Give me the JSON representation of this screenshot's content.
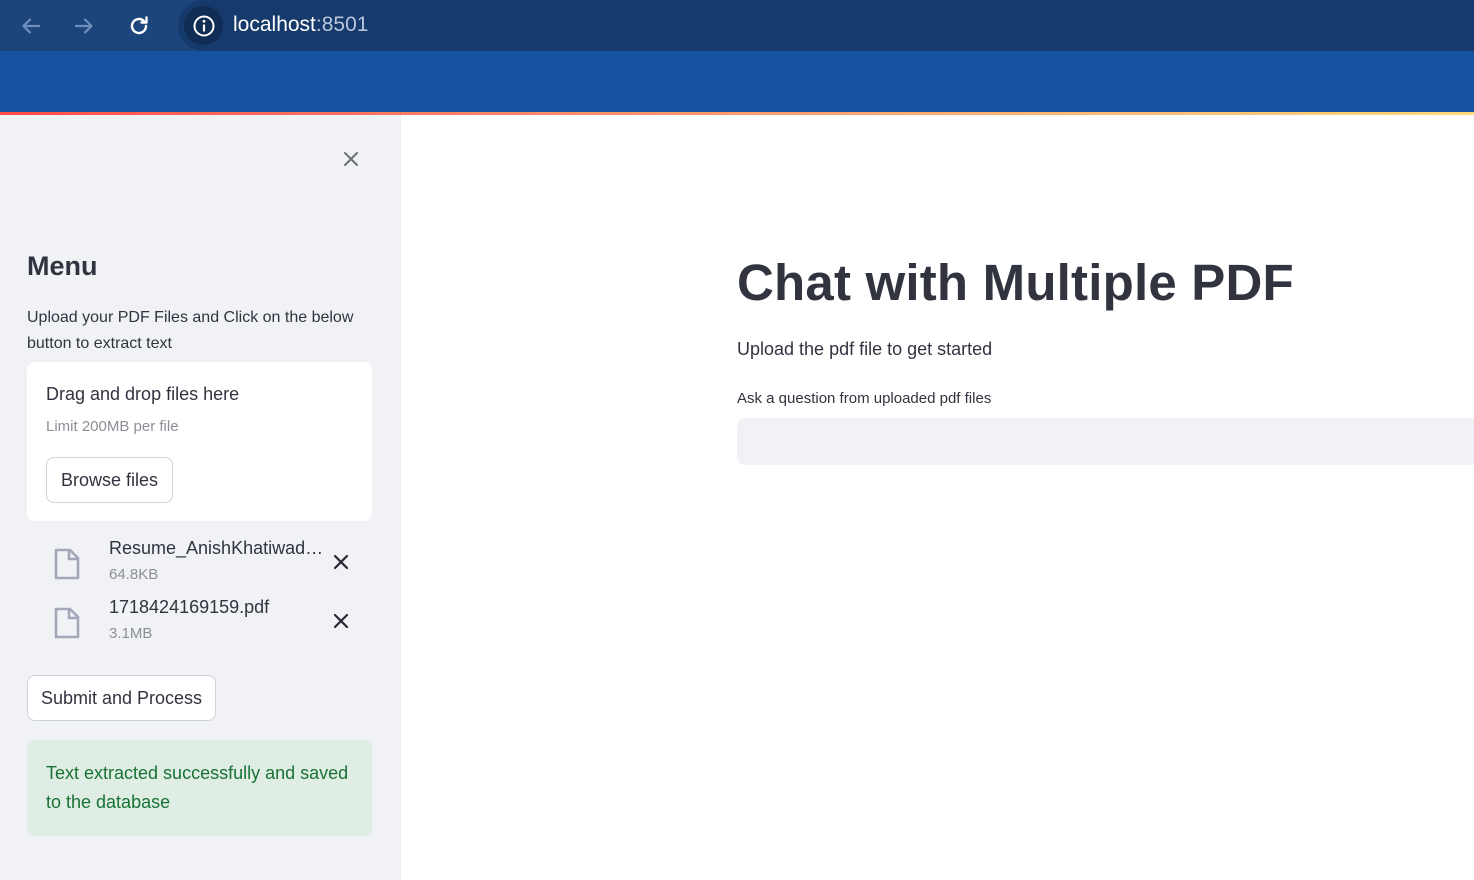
{
  "browser": {
    "url_host": "localhost",
    "url_port": ":8501",
    "back_icon": "arrow-left-icon",
    "forward_icon": "arrow-right-icon",
    "reload_icon": "reload-icon",
    "site_info_icon": "info-icon"
  },
  "sidebar": {
    "close_icon": "close-icon",
    "title": "Menu",
    "description": "Upload your PDF Files and Click on the below button to extract text",
    "uploader": {
      "drop_text": "Drag and drop files here",
      "limit_text": "Limit 200MB per file",
      "browse_label": "Browse files"
    },
    "files": [
      {
        "name": "Resume_AnishKhatiwada.pdf",
        "size": "64.8KB",
        "icon": "file-icon",
        "remove_icon": "close-icon"
      },
      {
        "name": "1718424169159.pdf",
        "size": "3.1MB",
        "icon": "file-icon",
        "remove_icon": "close-icon"
      }
    ],
    "submit_label": "Submit and Process",
    "success_message": "Text extracted successfully and saved to the database"
  },
  "main": {
    "title": "Chat with Multiple PDF",
    "subtitle": "Upload the pdf file to get started",
    "question_label": "Ask a question from uploaded pdf files",
    "question_value": ""
  },
  "colors": {
    "chrome_top": "#1c457c",
    "chrome_body": "#1553a0",
    "sidebar_bg": "#f0f2f6",
    "success_bg": "#dfede5",
    "success_text": "#177233",
    "text": "#31333f"
  }
}
